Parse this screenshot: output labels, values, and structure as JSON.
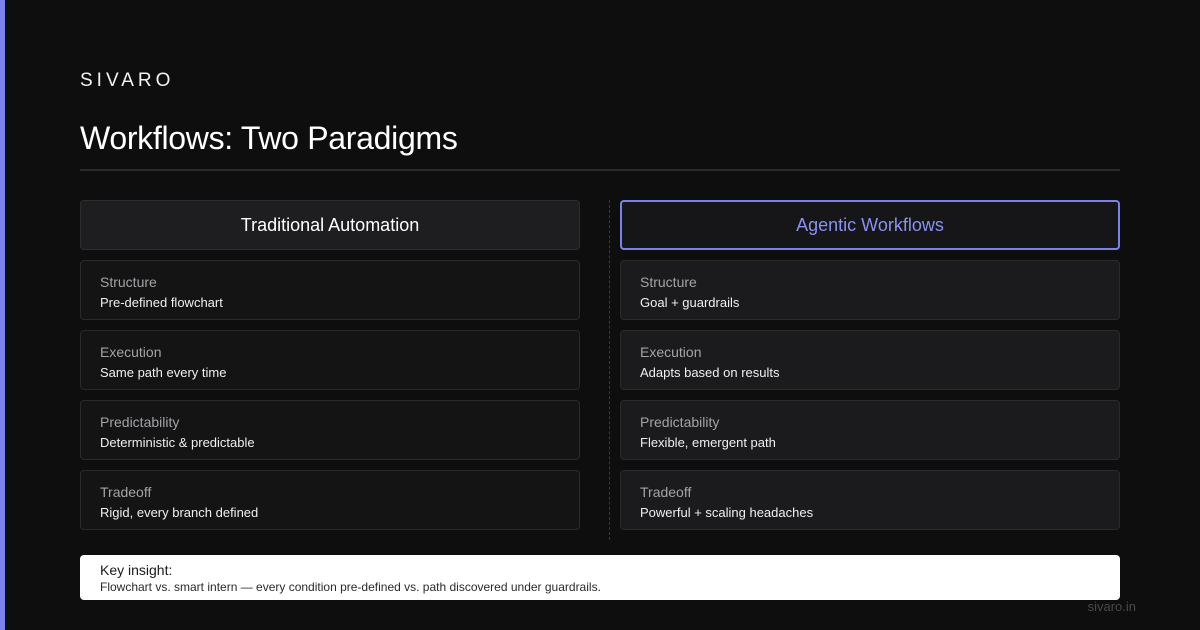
{
  "brand": "SIVARO",
  "title": "Workflows: Two Paradigms",
  "columns": [
    {
      "header": "Traditional Automation",
      "rows": [
        {
          "label": "Structure",
          "value": "Pre-defined flowchart"
        },
        {
          "label": "Execution",
          "value": "Same path every time"
        },
        {
          "label": "Predictability",
          "value": "Deterministic & predictable"
        },
        {
          "label": "Tradeoff",
          "value": "Rigid, every branch defined"
        }
      ]
    },
    {
      "header": "Agentic Workflows",
      "rows": [
        {
          "label": "Structure",
          "value": "Goal + guardrails"
        },
        {
          "label": "Execution",
          "value": "Adapts based on results"
        },
        {
          "label": "Predictability",
          "value": "Flexible, emergent path"
        },
        {
          "label": "Tradeoff",
          "value": "Powerful + scaling headaches"
        }
      ]
    }
  ],
  "insight": {
    "label": "Key insight:",
    "text": "Flowchart vs. smart intern — every condition pre-defined vs. path discovered under guardrails."
  },
  "footer_url": "sivaro.in",
  "colors": {
    "accent": "#7b83eb",
    "background": "#0e0e0f"
  }
}
